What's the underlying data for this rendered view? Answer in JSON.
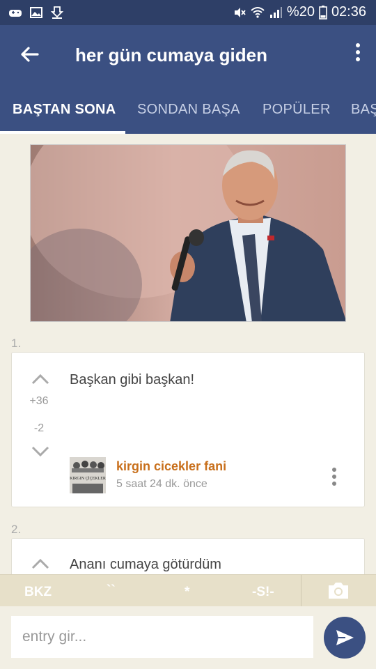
{
  "status_bar": {
    "battery": "%20",
    "time": "02:36"
  },
  "toolbar": {
    "title": "her gün cumaya giden"
  },
  "tabs": [
    {
      "label": "BAŞTAN SONA",
      "active": true
    },
    {
      "label": "SONDAN BAŞA",
      "active": false
    },
    {
      "label": "POPÜLER",
      "active": false
    },
    {
      "label": "BAŞ",
      "active": false
    }
  ],
  "entries": [
    {
      "number": "1.",
      "text": "Başkan gibi başkan!",
      "upvotes": "+36",
      "downvotes": "-2",
      "author": "kirgin cicekler fani",
      "time": "5 saat 24 dk. önce",
      "avatar_text": "KIRGIN ÇİÇEKLER"
    },
    {
      "number": "2.",
      "text": "Ananı cumaya götürdüm"
    }
  ],
  "format_bar": {
    "bkz": "BKZ",
    "backtick": "``",
    "star": "*",
    "spoiler": "-S!-"
  },
  "input": {
    "placeholder": "entry gir..."
  },
  "colors": {
    "primary": "#3b5082",
    "status_bar": "#2e3f67",
    "author": "#c86f1b",
    "background": "#f2efe4"
  }
}
